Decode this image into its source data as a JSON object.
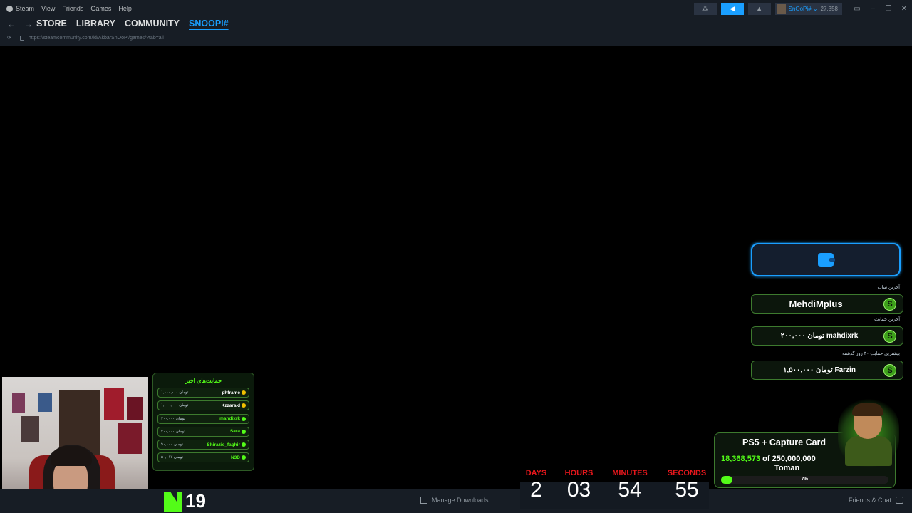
{
  "app": {
    "menu": [
      "Steam",
      "View",
      "Friends",
      "Games",
      "Help"
    ],
    "user_name": "SnOoPi# ⌄",
    "balance": "27,358"
  },
  "nav": {
    "tabs": [
      "STORE",
      "LIBRARY",
      "COMMUNITY",
      "SNOOPI#"
    ],
    "url": "https://steamcommunity.com/id/AkbarSnOoPi/games/?tab=all"
  },
  "bottom": {
    "manage_downloads": "Manage Downloads",
    "friends_chat": "Friends & Chat"
  },
  "kick": {
    "viewers": "19"
  },
  "recent_donations": {
    "title": "حمایت‌های اخیر",
    "items": [
      {
        "name": "phframe",
        "amount": "۱,۰۰۰,۰۰۰ تومان",
        "color": "gold"
      },
      {
        "name": "Kzzarakl",
        "amount": "۱,۰۰۰,۰۰۰ تومان",
        "color": "gold"
      },
      {
        "name": "mahdixrk",
        "amount": "۲۰۰,۰۰۰ تومان",
        "color": "green"
      },
      {
        "name": "Sara",
        "amount": "۲۰۰,۰۰۰ تومان",
        "color": "green"
      },
      {
        "name": "Shirazie_faghir",
        "amount": "۹۰,۰۰۰ تومان",
        "color": "green"
      },
      {
        "name": "N3D",
        "amount": "۵۰,۰۱۷ تومان",
        "color": "green"
      }
    ]
  },
  "countdown": {
    "labels": [
      "DAYS",
      "HOURS",
      "MINUTES",
      "SECONDS"
    ],
    "values": [
      "2",
      "03",
      "54",
      "55"
    ]
  },
  "widgets": {
    "last_sub_caption": "آخرین ساب",
    "last_sub": "MehdiMplus",
    "last_donation_caption": "آخرین حمایت",
    "last_donation": "۲۰۰,۰۰۰ تومان   mahdixrk",
    "top_donation_caption": "بیشترین حمایت ۳۰ روز گذشته",
    "top_donation": "۱,۵۰۰,۰۰۰ تومان   Farzin",
    "badge": "S"
  },
  "goal": {
    "title": "PS5 + Capture Card",
    "current": "18,368,573",
    "of": "of",
    "target": "250,000,000",
    "currency": "Toman",
    "percent_label": "7%",
    "fill_fraction": 0.07
  },
  "colors": {
    "steam_blue": "#1a9fff",
    "kick_green": "#53fc18",
    "countdown_red": "#e8171c"
  }
}
